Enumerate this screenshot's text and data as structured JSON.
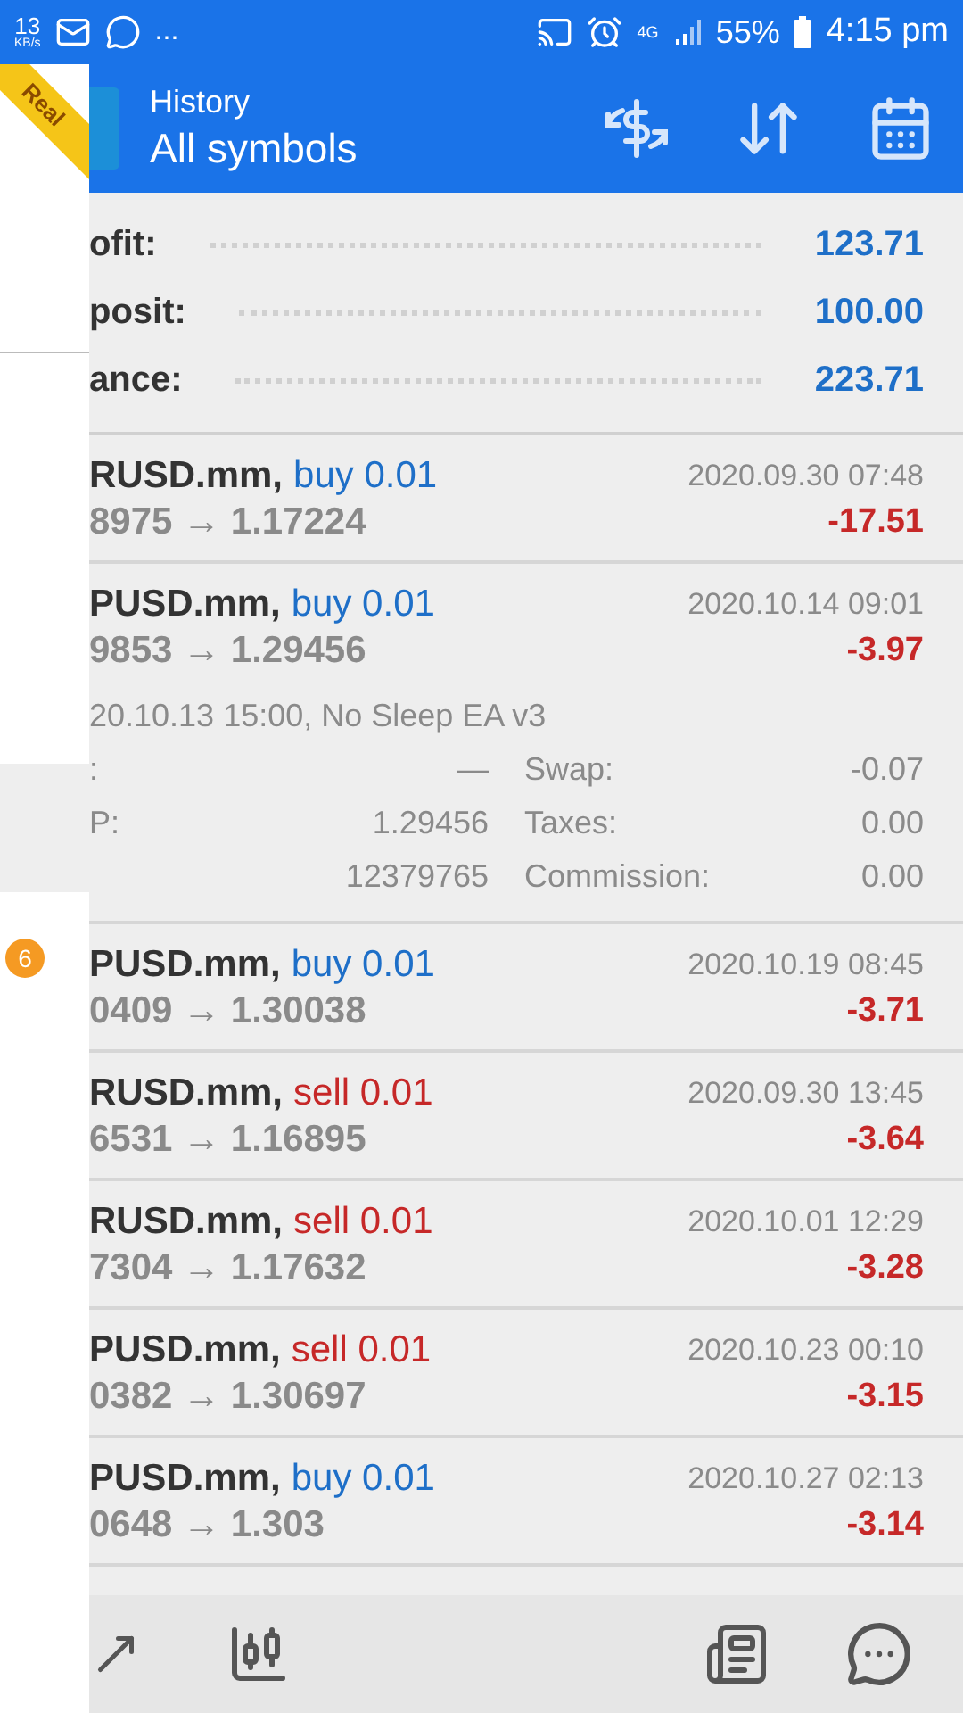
{
  "status_bar": {
    "speed": "13",
    "speed_unit": "KB/s",
    "more": "...",
    "network": "4G",
    "battery": "55%",
    "time": "4:15 pm"
  },
  "drawer": {
    "ribbon": "Real",
    "badge": "6",
    "highlighted": true
  },
  "header": {
    "title": "History",
    "subtitle": "All symbols"
  },
  "summary": [
    {
      "label": "ofit:",
      "value": "123.71"
    },
    {
      "label": "posit:",
      "value": "100.00"
    },
    {
      "label": "ance:",
      "value": "223.71"
    }
  ],
  "deals": [
    {
      "symbol": "RUSD.mm,",
      "kind": "buy",
      "action": "buy 0.01",
      "prices": "8975 → 1.17224",
      "time": "2020.09.30 07:48",
      "profit": "-17.51",
      "expanded": false
    },
    {
      "symbol": "PUSD.mm,",
      "kind": "buy",
      "action": "buy 0.01",
      "prices": "9853 → 1.29456",
      "time": "2020.10.14 09:01",
      "profit": "-3.97",
      "expanded": true,
      "open_info": "20.10.13 15:00, No Sleep EA v3",
      "details": [
        {
          "label": ":",
          "value": "—",
          "label_2": "Swap:",
          "value_2": "-0.07"
        },
        {
          "label": "P:",
          "value": "1.29456",
          "label_2": "Taxes:",
          "value_2": "0.00"
        },
        {
          "value": "12379765",
          "label_2": "Commission:",
          "value_2": "0.00"
        }
      ]
    },
    {
      "symbol": "PUSD.mm,",
      "kind": "buy",
      "action": "buy 0.01",
      "prices": "0409 → 1.30038",
      "time": "2020.10.19 08:45",
      "profit": "-3.71",
      "expanded": false
    },
    {
      "symbol": "RUSD.mm,",
      "kind": "sell",
      "action": "sell 0.01",
      "prices": "6531 → 1.16895",
      "time": "2020.09.30 13:45",
      "profit": "-3.64",
      "expanded": false
    },
    {
      "symbol": "RUSD.mm,",
      "kind": "sell",
      "action": "sell 0.01",
      "prices": "7304 → 1.17632",
      "time": "2020.10.01 12:29",
      "profit": "-3.28",
      "expanded": false
    },
    {
      "symbol": "PUSD.mm,",
      "kind": "sell",
      "action": "sell 0.01",
      "prices": "0382 → 1.30697",
      "time": "2020.10.23 00:10",
      "profit": "-3.15",
      "expanded": false
    },
    {
      "symbol": "PUSD.mm,",
      "kind": "buy",
      "action": "buy 0.01",
      "prices": "0648 → 1.303",
      "time": "2020.10.27 02:13",
      "profit": "-3.14",
      "expanded": false
    }
  ]
}
